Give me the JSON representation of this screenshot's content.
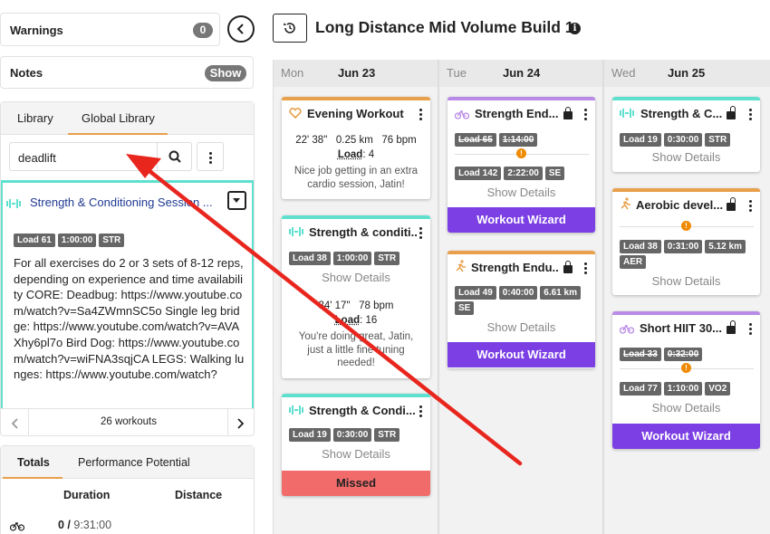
{
  "left": {
    "warnings": {
      "label": "Warnings",
      "count": "0"
    },
    "notes": {
      "label": "Notes",
      "show": "Show"
    },
    "tabs": [
      {
        "label": "Library"
      },
      {
        "label": "Global Library"
      }
    ],
    "search": {
      "value": "deadlift"
    },
    "session": {
      "title": "Strength & Conditioning Session ...",
      "tags": [
        "Load 61",
        "1:00:00",
        "STR"
      ],
      "description": "For all exercises do 2 or 3 sets of 8-12 reps, depending on experience and time availability CORE: Deadbug: https://www.youtube.com/watch?v=Sa4ZWmnSC5o Single leg bridge: https://www.youtube.com/watch?v=AVAXhy6pl7o Bird Dog: https://www.youtube.com/watch?v=wiFNA3sqjCA LEGS: Walking lunges: https://www.youtube.com/watch?"
    },
    "pagination": {
      "count": "26 workouts"
    },
    "totals_tabs": [
      {
        "label": "Totals"
      },
      {
        "label": "Performance Potential"
      }
    ],
    "totals_headers": {
      "duration": "Duration",
      "distance": "Distance"
    },
    "totals_row": {
      "done": "0",
      "sep": " / ",
      "total": "9:31:00"
    }
  },
  "header": {
    "title": "Long Distance Mid Volume Build 1"
  },
  "columns": [
    {
      "day": "Mon",
      "date": "Jun 23"
    },
    {
      "day": "Tue",
      "date": "Jun 24"
    },
    {
      "day": "Wed",
      "date": "Jun 25"
    }
  ],
  "cards": {
    "mon1": {
      "title": "Evening Workout",
      "time": "22' 38\"",
      "dist": "0.25 km",
      "hr": "76 bpm",
      "load_label": "Load",
      "load": ": 4",
      "comment": "Nice job getting in an extra cardio session, Jatin!"
    },
    "mon2": {
      "title": "Strength & conditi...",
      "tags": [
        "Load 38",
        "1:00:00",
        "STR"
      ],
      "show": "Show Details",
      "time": "34' 17\"",
      "hr": "78 bpm",
      "load_label": "Load",
      "load": ": 16",
      "comment": "You're doing great, Jatin, just a little fine tuning needed!"
    },
    "mon3": {
      "title": "Strength & Condi...",
      "tags": [
        "Load 19",
        "0:30:00",
        "STR"
      ],
      "show": "Show Details",
      "status": "Missed"
    },
    "tue1": {
      "title": "Strength End...",
      "old_tags": [
        "Load 65",
        "1:14:00"
      ],
      "tags": [
        "Load 142",
        "2:22:00",
        "SE"
      ],
      "show": "Show Details",
      "action": "Workout Wizard"
    },
    "tue2": {
      "title": "Strength Endu...",
      "tags": [
        "Load 49",
        "0:40:00",
        "6.61 km",
        "SE"
      ],
      "show": "Show Details",
      "action": "Workout Wizard"
    },
    "wed1": {
      "title": "Strength & C...",
      "tags": [
        "Load 19",
        "0:30:00",
        "STR"
      ],
      "show": "Show Details"
    },
    "wed2": {
      "title": "Aerobic devel...",
      "tags": [
        "Load 38",
        "0:31:00",
        "5.12 km",
        "AER"
      ],
      "show": "Show Details"
    },
    "wed3": {
      "title": "Short HIIT 30...",
      "old_tags": [
        "Load 33",
        "0:32:00"
      ],
      "tags": [
        "Load 77",
        "1:10:00",
        "VO2"
      ],
      "show": "Show Details",
      "action": "Workout Wizard"
    }
  },
  "colors": {
    "accent": "#7b3fe4",
    "teal": "#5fe0cf",
    "orange": "#e8a04c",
    "purple": "#b98be6",
    "missed": "#f26b6b",
    "arrow": "#e8261e"
  }
}
